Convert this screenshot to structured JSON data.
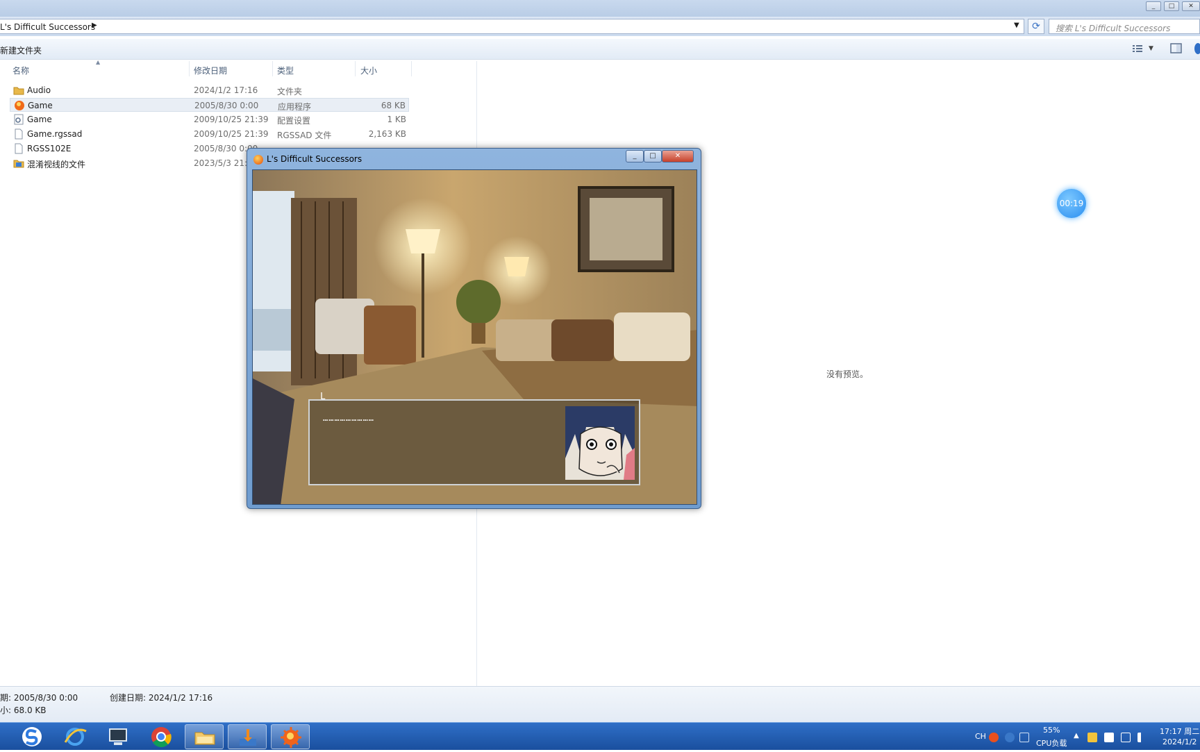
{
  "explorer": {
    "path": "L's Difficult Successors",
    "search_placeholder": "搜索 L's Difficult Successors",
    "toolbar": {
      "new_folder": "新建文件夹"
    },
    "columns": {
      "name": "名称",
      "date": "修改日期",
      "type": "类型",
      "size": "大小"
    },
    "files": [
      {
        "icon": "folder-icon",
        "name": "Audio",
        "date": "2024/1/2 17:16",
        "type": "文件夹",
        "size": ""
      },
      {
        "icon": "game-exe-icon",
        "name": "Game",
        "date": "2005/8/30 0:00",
        "type": "应用程序",
        "size": "68 KB",
        "selected": true
      },
      {
        "icon": "config-file-icon",
        "name": "Game",
        "date": "2009/10/25 21:39",
        "type": "配置设置",
        "size": "1 KB"
      },
      {
        "icon": "file-icon",
        "name": "Game.rgssad",
        "date": "2009/10/25 21:39",
        "type": "RGSSAD 文件",
        "size": "2,163 KB"
      },
      {
        "icon": "file-icon",
        "name": "RGSS102E",
        "date": "2005/8/30 0:00",
        "type": "",
        "size": ""
      },
      {
        "icon": "video-folder-icon",
        "name": "混淆视线的文件",
        "date": "2023/5/3 21:",
        "type": "",
        "size": ""
      }
    ],
    "preview_text": "没有预览。",
    "details": {
      "modified": "期: 2005/8/30 0:00",
      "created": "创建日期: 2024/1/2 17:16",
      "size": "小: 68.0 KB"
    }
  },
  "game_window": {
    "title": "L's Difficult Successors",
    "speaker": "L",
    "dialog_text": "………………………"
  },
  "timer_badge": "00:19",
  "taskbar": {
    "apps": [
      "sogou-icon",
      "ie-icon",
      "computer-icon",
      "chrome-icon",
      "explorer-icon",
      "installer-icon",
      "game-icon"
    ],
    "tray": {
      "lang": "CH",
      "cpu_percent": "55%",
      "cpu_label": "CPU负载",
      "time": "17:17 周二",
      "date": "2024/1/2"
    }
  }
}
